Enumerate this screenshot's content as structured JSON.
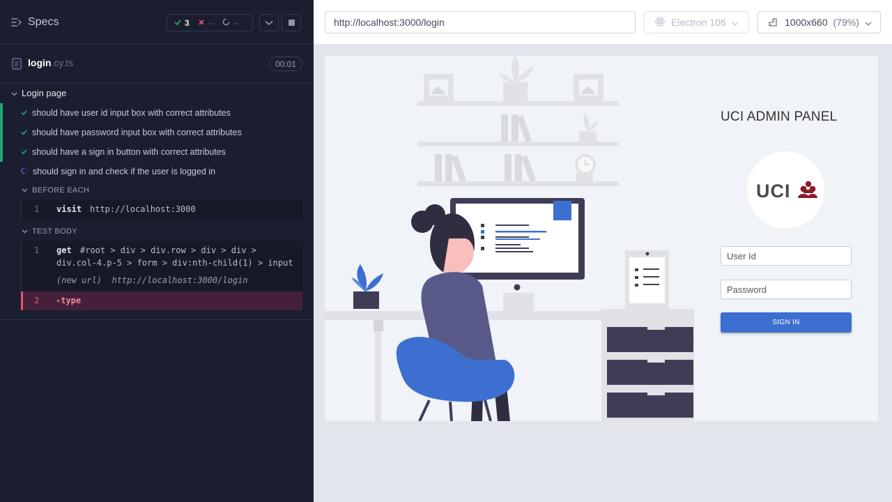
{
  "reporter": {
    "specs_label": "Specs",
    "stats": {
      "passed": "3",
      "failed": "--",
      "pending": "--"
    },
    "file": {
      "base": "login",
      "ext": ".cy.ts",
      "duration": "00:01"
    },
    "suite": {
      "title": "Login page",
      "tests": [
        {
          "title": "should have user id input box with correct attributes",
          "state": "passed"
        },
        {
          "title": "should have password input box with correct attributes",
          "state": "passed"
        },
        {
          "title": "should have a sign in button with correct attributes",
          "state": "passed"
        },
        {
          "title": "should sign in and check if the user is logged in",
          "state": "running"
        }
      ]
    },
    "before_each": {
      "title": "BEFORE EACH",
      "commands": [
        {
          "num": "1",
          "name": "visit",
          "message": "http://localhost:3000"
        }
      ]
    },
    "test_body": {
      "title": "TEST BODY",
      "commands": [
        {
          "num": "1",
          "name": "get",
          "message_line1": "#root > div > div.row > div > div >",
          "message_line2": "div.col-4.p-5 > form > div:nth-child(1) > input"
        },
        {
          "num": "2",
          "name": "-type",
          "state": "failed"
        }
      ],
      "new_url_label": "(new url)",
      "new_url": "http://localhost:3000/login"
    },
    "colors": {
      "passed": "#1fa971",
      "failed": "#e45770",
      "running": "#4956e3"
    }
  },
  "aut": {
    "url": "http://localhost:3000/login",
    "browser": "Electron 106",
    "viewport": "1000x660",
    "scale": "(79%)"
  },
  "app": {
    "title": "UCI ADMIN PANEL",
    "logo_text": "UCI",
    "user_placeholder": "User Id",
    "password_placeholder": "Password",
    "signin_label": "SIGN IN",
    "accent": "#3d6fd0"
  }
}
